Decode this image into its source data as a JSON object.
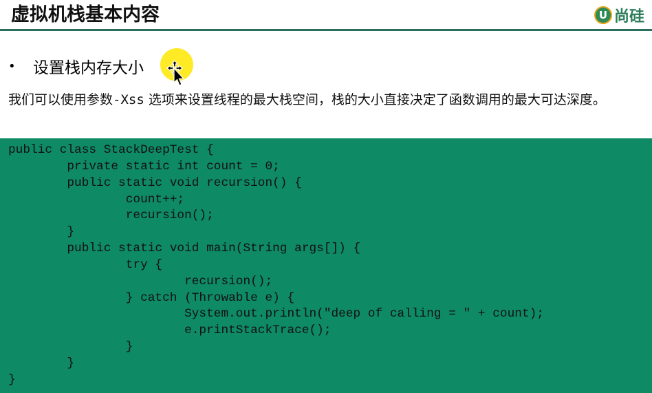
{
  "slide": {
    "title": "虚拟机栈基本内容",
    "logo": {
      "badge_letter": "U",
      "brand_text": "尚硅"
    },
    "bullet": {
      "marker": "•",
      "text": "设置栈内存大小"
    },
    "description": {
      "before": "我们可以使用参数",
      "option": "-Xss",
      "after": " 选项来设置线程的最大栈空间，栈的大小直接决定了函数调用的最大可达深度。"
    },
    "code_lines": [
      "public class StackDeepTest {",
      "        private static int count = 0;",
      "        public static void recursion() {",
      "                count++;",
      "                recursion();",
      "        }",
      "        public static void main(String args[]) {",
      "                try {",
      "                        recursion();",
      "                } catch (Throwable e) {",
      "                        System.out.println(\"deep of calling = \" + count);",
      "                        e.printStackTrace();",
      "                }",
      "        }",
      "}"
    ]
  },
  "colors": {
    "accent_green": "#0e8a64",
    "title_rule": "#2a6f5b",
    "highlight_yellow": "#ffe600"
  },
  "icons": {
    "cursor": "mouse-pointer-icon",
    "logo": "brand-logo-icon"
  }
}
